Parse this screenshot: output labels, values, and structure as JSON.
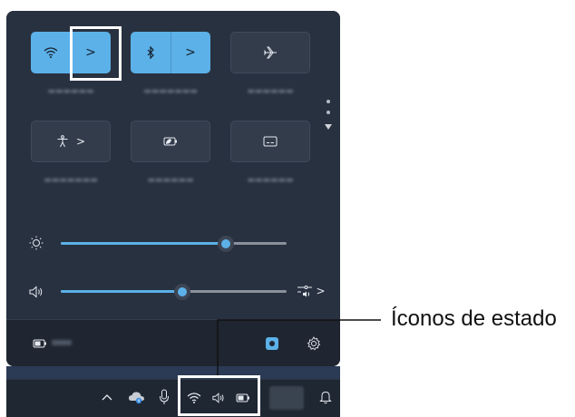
{
  "tiles": {
    "wifi_arrow": ">",
    "bluetooth_arrow": ">",
    "accessibility_arrow": ">"
  },
  "sliders": {
    "brightness": 0.73,
    "volume": 0.54,
    "volume_more_arrow": ">"
  },
  "callout": {
    "label": "Íconos de estado"
  }
}
